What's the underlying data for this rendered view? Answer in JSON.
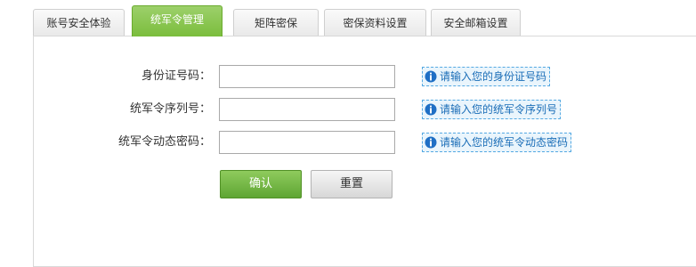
{
  "tabs": [
    {
      "label": "账号安全体验",
      "active": false
    },
    {
      "label": "统军令管理",
      "active": true
    },
    {
      "label": "矩阵密保",
      "active": false
    },
    {
      "label": "密保资料设置",
      "active": false
    },
    {
      "label": "安全邮箱设置",
      "active": false
    }
  ],
  "form": {
    "fields": [
      {
        "label": "身份证号码：",
        "value": "",
        "hint": "请输入您的身份证号码"
      },
      {
        "label": "统军令序列号：",
        "value": "",
        "hint": "请输入您的统军令序列号"
      },
      {
        "label": "统军令动态密码：",
        "value": "",
        "hint": "请输入您的统军令动态密码"
      }
    ],
    "confirm_label": "确认",
    "reset_label": "重置"
  },
  "colors": {
    "active_tab": "#7bbd3c",
    "confirm_button": "#5ea533",
    "hint_border": "#55a9e2",
    "hint_text": "#1a6db7"
  },
  "icons": {
    "hint": "info-icon"
  }
}
